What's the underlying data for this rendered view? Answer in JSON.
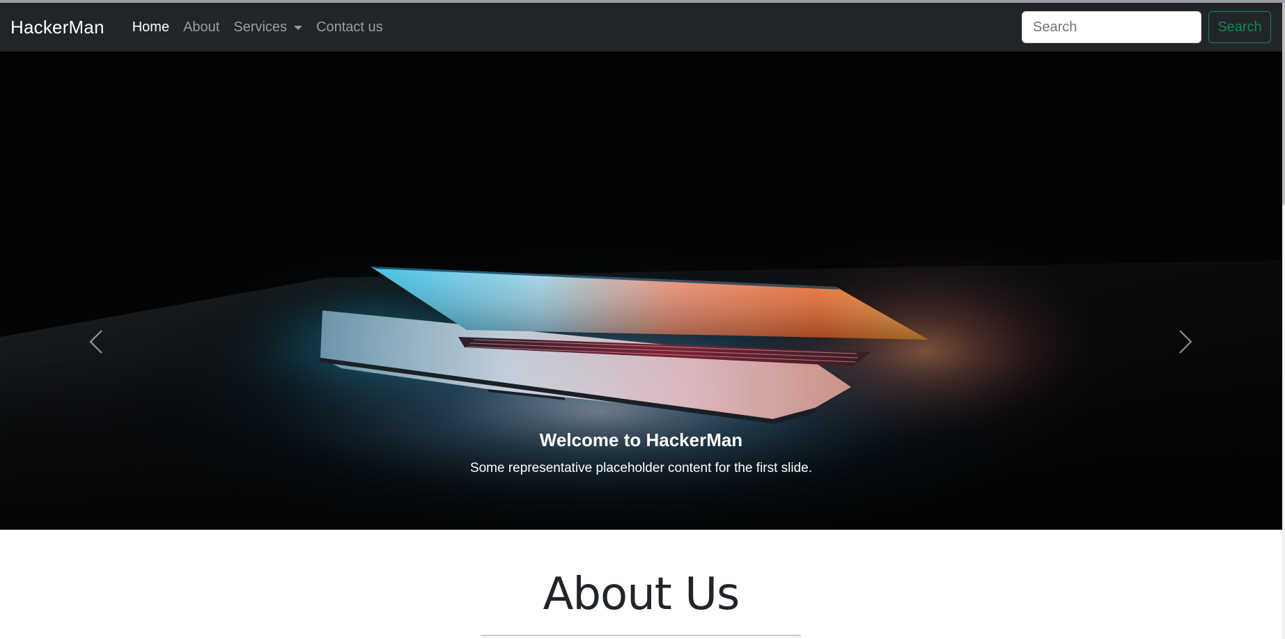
{
  "navbar": {
    "brand": "HackerMan",
    "links": [
      {
        "label": "Home",
        "active": true
      },
      {
        "label": "About",
        "active": false
      },
      {
        "label": "Services",
        "active": false,
        "dropdown": true
      },
      {
        "label": "Contact us",
        "active": false
      }
    ],
    "search": {
      "placeholder": "Search",
      "value": "",
      "button_label": "Search"
    }
  },
  "carousel": {
    "slide_title": "Welcome to HackerMan",
    "slide_text": "Some representative placeholder content for the first slide.",
    "prev_icon": "chevron-left-icon",
    "next_icon": "chevron-right-icon"
  },
  "about": {
    "heading": "About Us"
  },
  "colors": {
    "navbar_bg": "#212529",
    "search_button": "#198754",
    "hero_bg": "#020304"
  }
}
